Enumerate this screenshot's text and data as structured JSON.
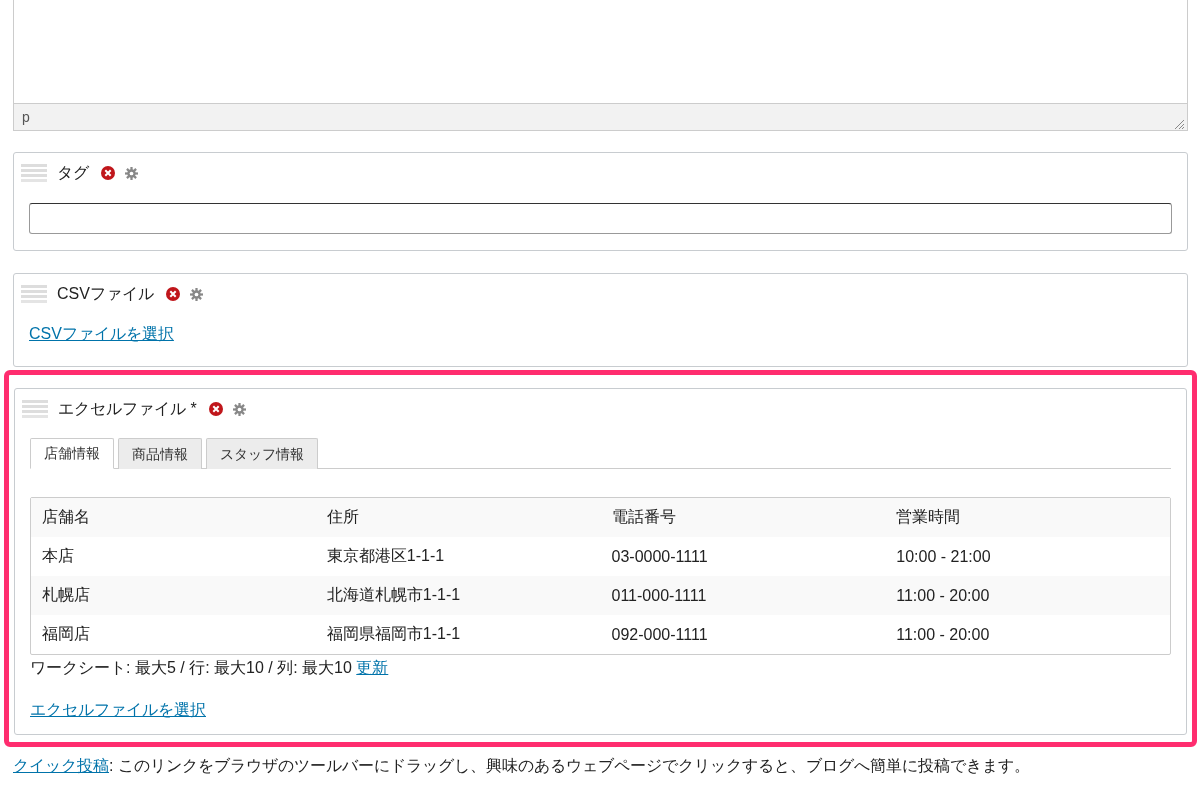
{
  "editor": {
    "status_path": "p"
  },
  "panels": [
    {
      "kind": "text",
      "title": "タグ",
      "highlighted": false
    },
    {
      "kind": "file",
      "title": "CSVファイル",
      "highlighted": false,
      "link": "CSVファイルを選択"
    },
    {
      "kind": "sheet",
      "title": "エクセルファイル *",
      "highlighted": true,
      "tabs": [
        {
          "label": "店舗情報",
          "selected": true
        },
        {
          "label": "商品情報",
          "selected": false
        },
        {
          "label": "スタッフ情報",
          "selected": false
        }
      ],
      "table": {
        "columns": [
          "店舗名",
          "住所",
          "電話番号",
          "営業時間"
        ],
        "rows": [
          [
            "本店",
            "東京都港区1-1-1",
            "03-0000-1111",
            "10:00 - 21:00"
          ],
          [
            "札幌店",
            "北海道札幌市1-1-1",
            "011-000-1111",
            "11:00 - 20:00"
          ],
          [
            "福岡店",
            "福岡県福岡市1-1-1",
            "092-000-1111",
            "11:00 - 20:00"
          ]
        ]
      },
      "info": "ワークシート: 最大5 / 行: 最大10 / 列: 最大10",
      "info_link": "更新",
      "link": "エクセルファイルを選択"
    }
  ],
  "footer": {
    "link": "クイック投稿",
    "text": ": このリンクをブラウザのツールバーにドラッグし、興味のあるウェブページでクリックすると、ブログへ簡単に投稿できます。"
  }
}
